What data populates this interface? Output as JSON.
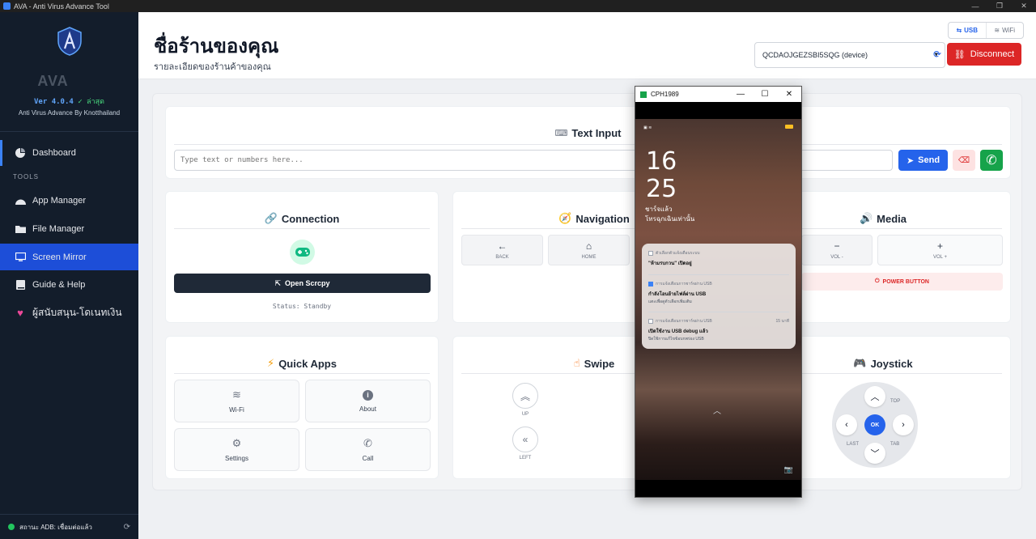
{
  "window": {
    "title": "AVA - Anti Virus Advance Tool"
  },
  "sidebar": {
    "app_name": "AVA",
    "version": "Ver 4.0.4",
    "version_badge": "✓ ล่าสุด",
    "subtitle": "Anti Virus Advance By Knotthailand",
    "tools_label": "TOOLS",
    "items": [
      {
        "label": "Dashboard"
      },
      {
        "label": "App Manager"
      },
      {
        "label": "File Manager"
      },
      {
        "label": "Screen Mirror"
      },
      {
        "label": "Guide & Help"
      },
      {
        "label": "ผู้สนับสนุน-โดเนทเงิน"
      }
    ],
    "status": "สถานะ ADB: เชื่อมต่อแล้ว"
  },
  "header": {
    "title": "ชื่อร้านของคุณ",
    "subtitle": "รายละเอียดของร้านค้าของคุณ",
    "usb_label": "USB",
    "wifi_label": "WiFi",
    "device": "QCDAOJGEZSBI5SQG (device)",
    "disconnect_label": "Disconnect"
  },
  "text_input": {
    "title": "Text Input",
    "placeholder": "Type text or numbers here...",
    "send_label": "Send"
  },
  "connection": {
    "title": "Connection",
    "open_label": "Open Scrcpy",
    "status": "Status: Standby"
  },
  "navigation": {
    "title": "Navigation",
    "back": "BACK",
    "home": "HOME"
  },
  "media": {
    "title": "Media",
    "vol_down": "VOL -",
    "vol_up": "VOL +",
    "power": "POWER BUTTON"
  },
  "quick_apps": {
    "title": "Quick Apps",
    "items": [
      {
        "label": "Wi-Fi"
      },
      {
        "label": "About"
      },
      {
        "label": "Settings"
      },
      {
        "label": "Call"
      }
    ]
  },
  "swipe": {
    "title": "Swipe",
    "up": "UP",
    "left": "LEFT"
  },
  "joystick": {
    "title": "Joystick",
    "ok": "OK",
    "top": "TOP",
    "last": "LAST",
    "tab": "TAB"
  },
  "mirror": {
    "title": "CPH1989",
    "hour": "16",
    "minute": "25",
    "charge": "ชาร์จแล้ว",
    "emergency": "โทรฉุกเฉินเท่านั้น",
    "notifications": [
      {
        "app": "ตัวเลือกตัวแจ้งเตือนระบบ",
        "title": "\"ห้ามรบกวน\" เปิดอยู่",
        "body": "",
        "time": ""
      },
      {
        "app": "การแจ้งเตือนการชาร์จผ่าน USB",
        "title": "กำลังโอนย้ายไฟล์ผ่าน USB",
        "body": "แตะเพื่อดูตัวเลือกเพิ่มเติม",
        "time": ""
      },
      {
        "app": "การแจ้งเตือนการชาร์จผ่าน USB",
        "title": "เปิดใช้งาน USB debug แล้ว",
        "body": "ปิดใช้การแก้ไขข้อบกพร่อง USB",
        "time": "15 นาที"
      }
    ]
  }
}
